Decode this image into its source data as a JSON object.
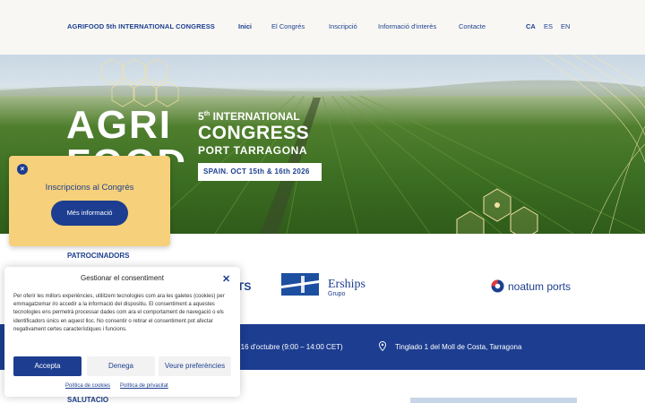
{
  "header": {
    "brand": "AGRIFOOD 5th INTERNATIONAL CONGRESS",
    "nav": [
      "Inici",
      "El Congrés",
      "Inscripció",
      "Informació d'interès",
      "Contacte"
    ],
    "languages": [
      "CA",
      "ES",
      "EN"
    ],
    "active_nav": "Inici",
    "active_language": "CA"
  },
  "hero": {
    "agri": "AGRI",
    "food": "FOOD",
    "intl_number": "5",
    "intl_suffix": "th",
    "intl_text": "INTERNATIONAL",
    "congress": "CONGRESS",
    "port": "PORT TARRAGONA",
    "date": "SPAIN. OCT 15th & 16th 2026"
  },
  "sponsors": {
    "title": "PATROCINADORS",
    "partial_logo_text": "TS",
    "ership_name": "Erships",
    "ership_sub": "Grupo",
    "noatum_name": "noatum ports"
  },
  "info_strip": {
    "dates": "– 16 d'octubre (9:00 – 14:00 CET)",
    "location": "Tinglado 1 del Moll de Costa, Tarragona"
  },
  "salutacio": "SALUTACIÓ",
  "popup": {
    "title": "Inscripcions al Congrés",
    "button": "Més informació"
  },
  "consent": {
    "title": "Gestionar el consentiment",
    "text": "Per oferir les millors experiències, utilitzem tecnologies com ara les galetes (cookies) per emmagatzemar i/o accedir a la informació del dispositiu. El consentiment a aquestes tecnologies ens permetrà processar dades com ara el comportament de navegació o els identificadors únics en aquest lloc. No consentir o retirar el consentiment pot afectar negativament certes característiques i funcions.",
    "accept": "Accepta",
    "deny": "Denega",
    "preferences": "Veure preferències",
    "cookie_policy": "Política de cookies",
    "privacy_policy": "Política de privacitat"
  },
  "colors": {
    "brand_blue": "#1c3d90",
    "popup_yellow": "#f6d07a",
    "header_bg": "#f8f7f4"
  }
}
